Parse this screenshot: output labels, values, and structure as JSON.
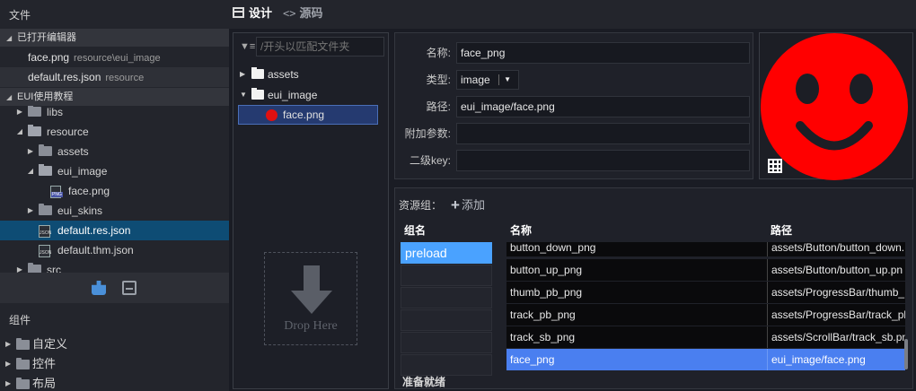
{
  "sidebar": {
    "files_title": "文件",
    "open_editors": {
      "title": "已打开编辑器",
      "items": [
        {
          "name": "face.png",
          "path": "resource\\eui_image"
        },
        {
          "name": "default.res.json",
          "path": "resource"
        }
      ]
    },
    "project": {
      "title": "EUI使用教程",
      "tree": [
        {
          "label": "libs"
        },
        {
          "label": "resource"
        },
        {
          "label": "assets"
        },
        {
          "label": "eui_image"
        },
        {
          "label": "face.png"
        },
        {
          "label": "eui_skins"
        },
        {
          "label": "default.res.json"
        },
        {
          "label": "default.thm.json"
        },
        {
          "label": "src"
        }
      ]
    },
    "components": {
      "title": "组件",
      "items": [
        {
          "label": "自定义"
        },
        {
          "label": "控件"
        },
        {
          "label": "布局"
        }
      ]
    }
  },
  "tabs": [
    {
      "label": "设计"
    },
    {
      "label": "源码"
    }
  ],
  "file_panel": {
    "filter_placeholder": "/开头以匹配文件夹",
    "tree": [
      {
        "label": "assets"
      },
      {
        "label": "eui_image"
      },
      {
        "label": "face.png"
      }
    ],
    "drop_label": "Drop Here"
  },
  "properties": {
    "name_label": "名称:",
    "name_value": "face_png",
    "type_label": "类型:",
    "type_value": "image",
    "path_label": "路径:",
    "path_value": "eui_image/face.png",
    "params_label": "附加参数:",
    "params_value": "",
    "subkey_label": "二级key:",
    "subkey_value": ""
  },
  "preview": {
    "fill_color": "#ff0000",
    "feature_color": "#1c1e25"
  },
  "resource_group": {
    "label": "资源组：",
    "add_label": "添加",
    "headers": {
      "group": "组名",
      "name": "名称",
      "path": "路径"
    },
    "groups": [
      {
        "name": "preload"
      }
    ],
    "rows": [
      {
        "name": "button_down_png",
        "path": "assets/Button/button_down."
      },
      {
        "name": "button_up_png",
        "path": "assets/Button/button_up.pn"
      },
      {
        "name": "thumb_pb_png",
        "path": "assets/ProgressBar/thumb_"
      },
      {
        "name": "track_pb_png",
        "path": "assets/ProgressBar/track_pb"
      },
      {
        "name": "track_sb_png",
        "path": "assets/ScrollBar/track_sb.pn"
      },
      {
        "name": "face_png",
        "path": "eui_image/face.png"
      }
    ],
    "status": "准备就绪"
  },
  "colors": {
    "accent": "#4a7ff0",
    "tree_selected": "#0e4c74",
    "group_selected": "#4aa2ff"
  }
}
